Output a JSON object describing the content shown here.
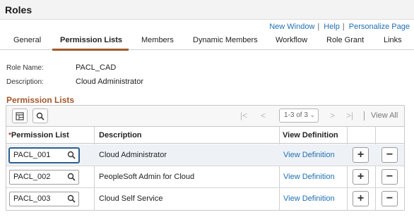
{
  "page": {
    "title": "Roles"
  },
  "top_links": [
    "New Window",
    "Help",
    "Personalize Page"
  ],
  "tabs": [
    {
      "label": "General",
      "active": false
    },
    {
      "label": "Permission Lists",
      "active": true
    },
    {
      "label": "Members",
      "active": false
    },
    {
      "label": "Dynamic Members",
      "active": false
    },
    {
      "label": "Workflow",
      "active": false
    },
    {
      "label": "Role Grant",
      "active": false
    },
    {
      "label": "Links",
      "active": false
    }
  ],
  "role": {
    "name_label": "Role Name:",
    "name_value": "PACL_CAD",
    "description_label": "Description:",
    "description_value": "Cloud Administrator"
  },
  "grid": {
    "title": "Permission Lists",
    "pagination": {
      "first": "|<",
      "prev": "<",
      "range": "1-3 of 3",
      "next": ">",
      "last": ">|",
      "view_all": "View All"
    },
    "columns": {
      "required_mark": "*",
      "permission_list": "Permission List",
      "description": "Description",
      "view_definition": "View Definition"
    },
    "rows": [
      {
        "permission_list": "PACL_001",
        "description": "Cloud Administrator",
        "view_definition": "View Definition",
        "add": "+",
        "remove": "−"
      },
      {
        "permission_list": "PACL_002",
        "description": "PeopleSoft Admin for Cloud",
        "view_definition": "View Definition",
        "add": "+",
        "remove": "−"
      },
      {
        "permission_list": "PACL_003",
        "description": "Cloud Self Service",
        "view_definition": "View Definition",
        "add": "+",
        "remove": "−"
      }
    ]
  },
  "icons": {
    "personalize": "grid-personalize-icon",
    "find": "search-icon",
    "lookup": "lookup-search-icon"
  },
  "colors": {
    "link": "#1f6fb2",
    "section_title": "#a3562b",
    "tab_underline": "#a05a2c",
    "required": "#c0392b"
  }
}
